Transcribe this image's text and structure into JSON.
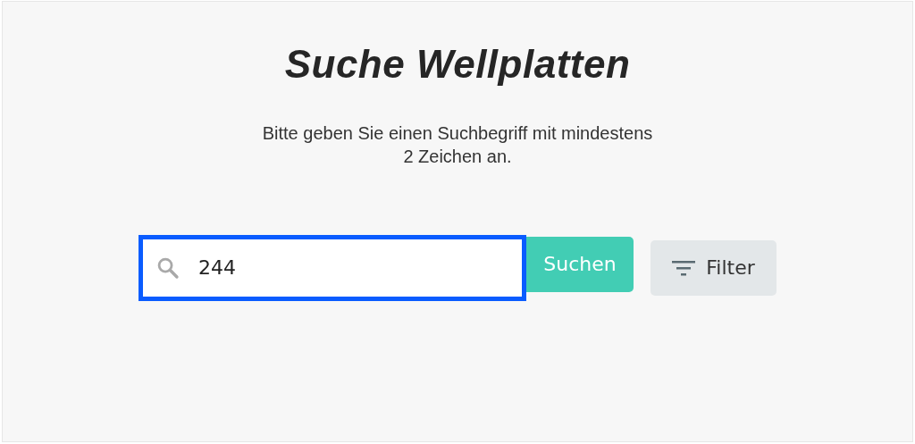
{
  "title": "Suche Wellplatten",
  "hint": "Bitte geben Sie einen Suchbegriff mit mindestens 2 Zeichen an.",
  "search": {
    "value": "244",
    "focused": true
  },
  "buttons": [
    {
      "label": "Suchen",
      "kind": "primary"
    },
    {
      "label": "Filter",
      "kind": "filter"
    }
  ]
}
